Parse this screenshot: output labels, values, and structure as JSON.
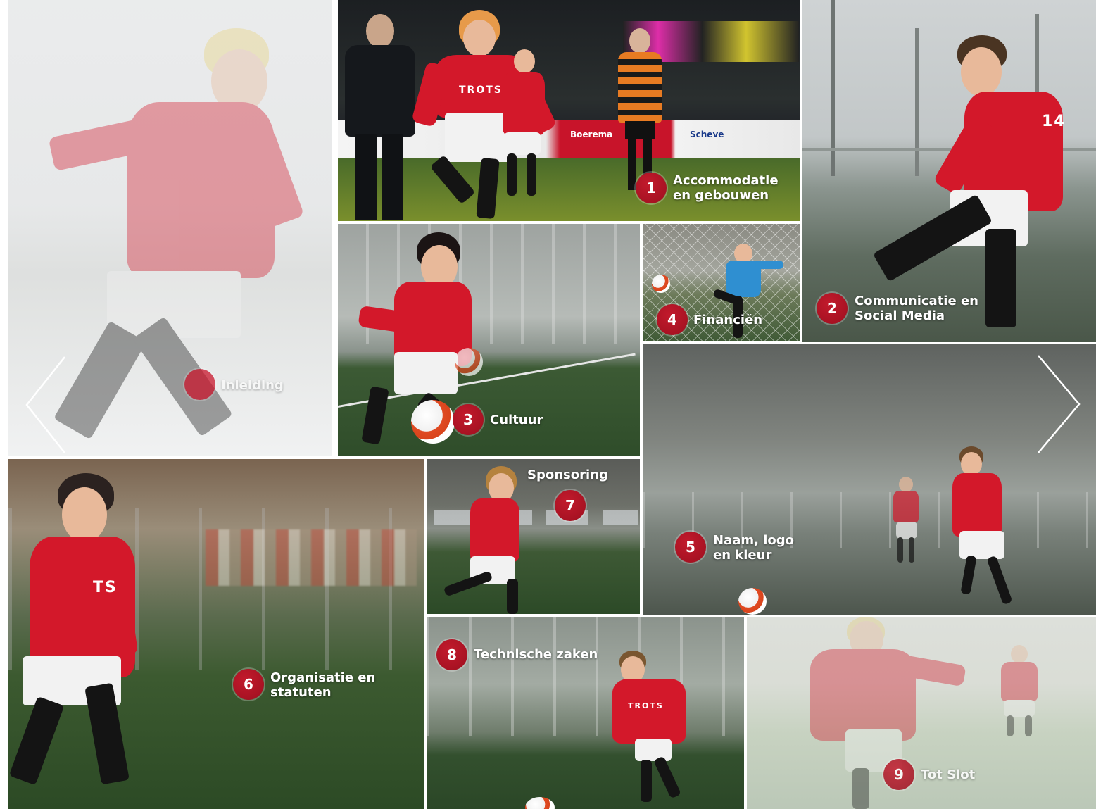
{
  "tiles": {
    "intro": {
      "label": "Inleiding"
    },
    "t1": {
      "number": "1",
      "line1": "Accommodatie",
      "line2": "en gebouwen"
    },
    "t2": {
      "number": "2",
      "line1": "Communicatie en",
      "line2": "Social Media"
    },
    "t3": {
      "number": "3",
      "label": "Cultuur"
    },
    "t4": {
      "number": "4",
      "label": "Financiën"
    },
    "t5": {
      "number": "5",
      "line1": "Naam, logo",
      "line2": "en kleur"
    },
    "t6": {
      "number": "6",
      "line1": "Organisatie en",
      "line2": "statuten"
    },
    "t7": {
      "number": "7",
      "label": "Sponsoring"
    },
    "t8": {
      "number": "8",
      "label": "Technische zaken"
    },
    "t9": {
      "number": "9",
      "label": "Tot Slot"
    }
  },
  "shirt_print": "TROTS",
  "banner_texts": {
    "sign1": "Boerema",
    "sign2": "Scheve"
  },
  "navigation": {
    "prev_icon": "chevron-left-icon",
    "next_icon": "chevron-right-icon"
  },
  "colors": {
    "badge": "#a8101f",
    "shirt": "#d3182a",
    "grass": "#2f4a2a"
  }
}
